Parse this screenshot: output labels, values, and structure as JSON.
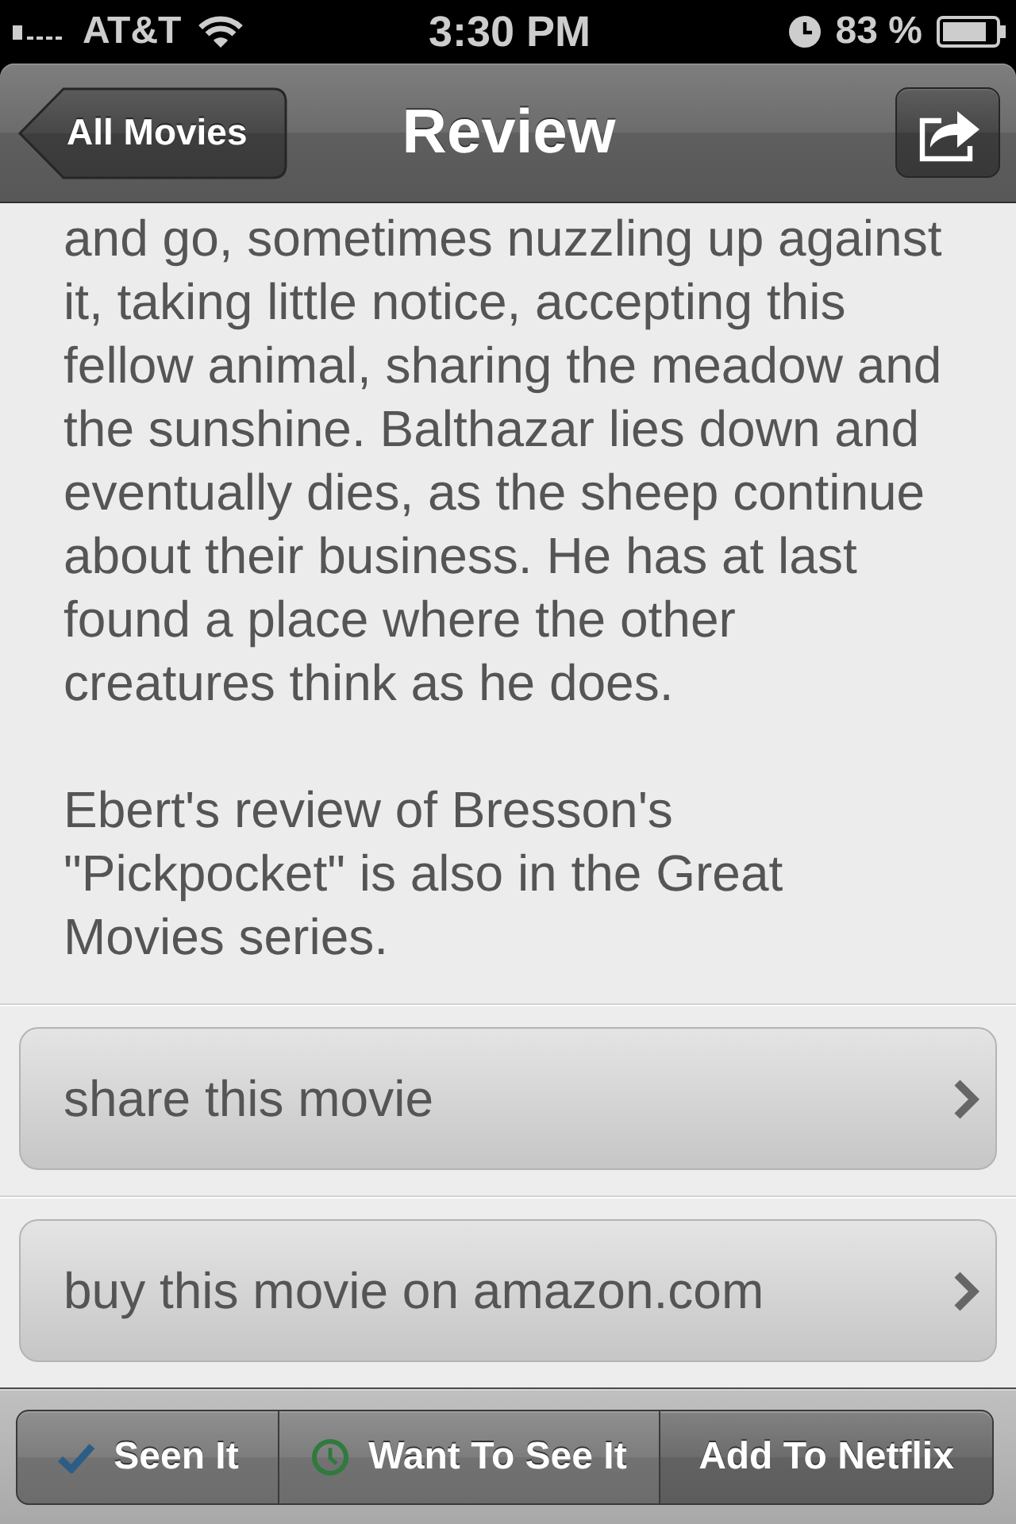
{
  "status_bar": {
    "carrier": "AT&T",
    "time": "3:30 PM",
    "battery_percent": "83 %"
  },
  "nav_bar": {
    "back_button": "All Movies",
    "title": "Review"
  },
  "review": {
    "paragraphs": [
      "and go, sometimes nuzzling up against it, taking little notice, accepting this fellow animal, sharing the meadow and the sunshine. Balthazar lies down and eventually dies, as the sheep continue about their business. He has at last found a place where the other creatures think as he does.",
      "Ebert's review of Bresson's \"Pickpocket\" is also in the Great Movies series."
    ]
  },
  "links": [
    "share this movie",
    "buy this movie on amazon.com"
  ],
  "toolbar": {
    "buttons": [
      {
        "label": "Seen It",
        "kind": "check"
      },
      {
        "label": "Want To See It",
        "kind": "clock"
      },
      {
        "label": "Add To Netflix",
        "kind": "plain"
      }
    ]
  }
}
